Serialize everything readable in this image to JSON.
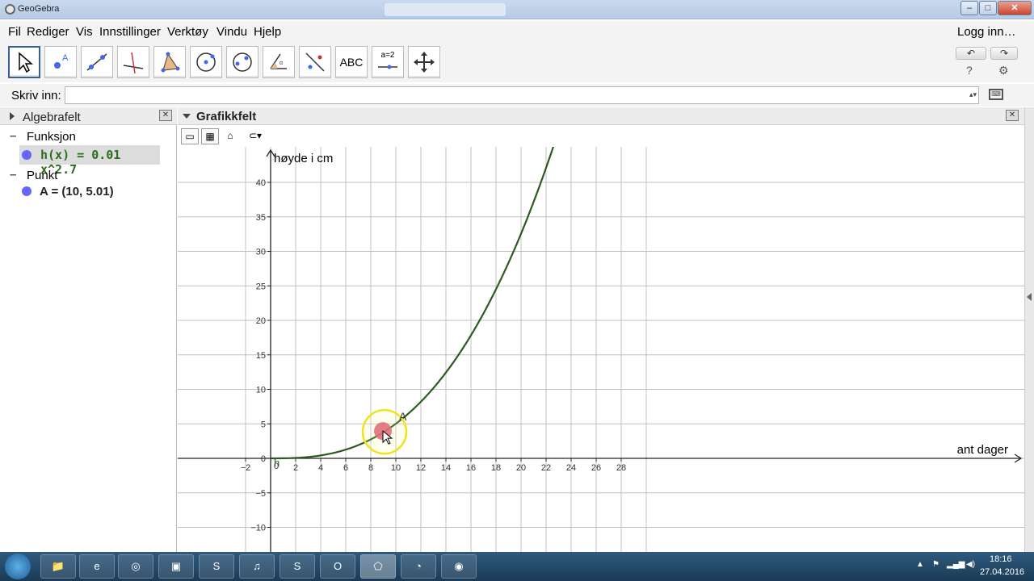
{
  "window": {
    "title": "GeoGebra",
    "center_title": ""
  },
  "menu": [
    "Fil",
    "Rediger",
    "Vis",
    "Innstillinger",
    "Verktøy",
    "Vindu",
    "Hjelp"
  ],
  "login": "Logg inn…",
  "toolbar": {
    "text_tool_label": "ABC",
    "slider_tool_label": "a=2",
    "undo": "↶",
    "redo": "↷",
    "help": "?",
    "settings": "⚙"
  },
  "input_bar": {
    "label": "Skriv inn:",
    "value": ""
  },
  "algebra": {
    "title": "Algebrafelt",
    "groups": [
      {
        "label": "Funksjon",
        "item": "h(x) = 0.01 x^2.7"
      },
      {
        "label": "Punkt",
        "item": "A = (10, 5.01)"
      }
    ]
  },
  "graphics": {
    "title": "Grafikkfelt"
  },
  "chart_data": {
    "type": "line",
    "xlabel": "ant dager",
    "ylabel": "høyde i cm",
    "xlim": [
      -3,
      30
    ],
    "ylim": [
      -12,
      44
    ],
    "x_ticks": [
      -2,
      2,
      4,
      6,
      8,
      10,
      12,
      14,
      16,
      18,
      20,
      22,
      24,
      26,
      28
    ],
    "y_ticks": [
      -10,
      -5,
      0,
      5,
      10,
      15,
      20,
      25,
      30,
      35,
      40
    ],
    "origin_label": "0",
    "grid": true,
    "function": {
      "name": "h",
      "coef": 0.01,
      "exp": 2.7,
      "color": "#2e5a22"
    },
    "point": {
      "name": "A",
      "x": 10,
      "y": 5.01
    }
  },
  "taskbar": {
    "time": "18:16",
    "date": "27.04.2016",
    "apps": [
      "📁",
      "e",
      "◎",
      "▣",
      "S",
      "♫",
      "S",
      "O",
      "⬠",
      "◔",
      "◉"
    ]
  }
}
